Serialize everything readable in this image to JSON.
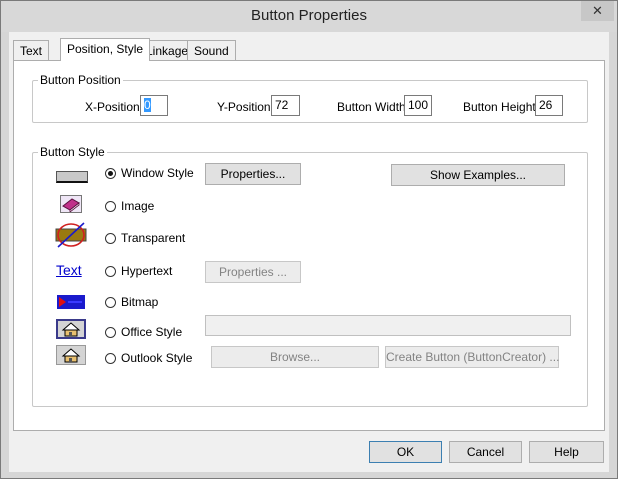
{
  "window": {
    "title": "Button Properties",
    "close_glyph": "✕"
  },
  "tabs": [
    {
      "label": "Text"
    },
    {
      "label": "Position, Style"
    },
    {
      "label": "Linkage"
    },
    {
      "label": "Sound"
    }
  ],
  "position": {
    "legend": "Button Position",
    "x_label": "X-Position",
    "x_value": "0",
    "y_label": "Y-Position",
    "y_value": "72",
    "w_label": "Button Width",
    "w_value": "100",
    "h_label": "Button Height",
    "h_value": "26"
  },
  "style": {
    "legend": "Button Style",
    "options": [
      {
        "label": "Window Style",
        "checked": true,
        "icon": "window-style-preview-icon"
      },
      {
        "label": "Image",
        "checked": false,
        "icon": "image-book-icon"
      },
      {
        "label": "Transparent",
        "checked": false,
        "icon": "transparent-slash-icon"
      },
      {
        "label": "Hypertext",
        "checked": false,
        "icon": "hypertext-link-icon"
      },
      {
        "label": "Bitmap",
        "checked": false,
        "icon": "bitmap-arrow-icon"
      },
      {
        "label": "Office Style",
        "checked": false,
        "icon": "office-house-icon"
      },
      {
        "label": "Outlook Style",
        "checked": false,
        "icon": "outlook-house-icon"
      }
    ],
    "hypertext_sample": "Text",
    "properties_btn": "Properties...",
    "show_examples_btn": "Show Examples...",
    "properties2_btn": "Properties ...",
    "image_path_value": "",
    "browse_btn": "Browse...",
    "create_btn": "Create Button (ButtonCreator) ..."
  },
  "footer": {
    "ok": "OK",
    "cancel": "Cancel",
    "help": "Help"
  },
  "colors": {
    "selection": "#3399ff",
    "link": "#0000cc",
    "bitmap_blue": "#1a1acc",
    "bitmap_red": "#e01010"
  }
}
